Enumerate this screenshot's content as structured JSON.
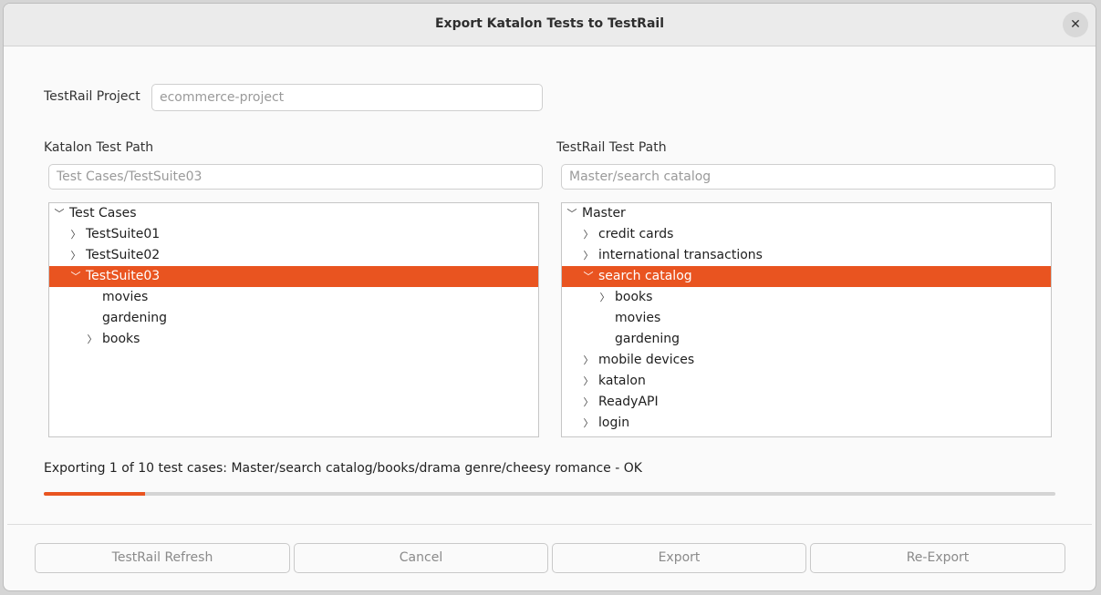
{
  "dialog": {
    "title": "Export Katalon Tests to TestRail",
    "close_glyph": "✕"
  },
  "project": {
    "label": "TestRail Project",
    "value": "ecommerce-project"
  },
  "katalon": {
    "label": "Katalon Test Path",
    "path": "Test Cases/TestSuite03",
    "tree": [
      {
        "label": "Test Cases",
        "level": 0,
        "expander": "expanded",
        "selected": false
      },
      {
        "label": "TestSuite01",
        "level": 1,
        "expander": "collapsed",
        "selected": false
      },
      {
        "label": "TestSuite02",
        "level": 1,
        "expander": "collapsed",
        "selected": false
      },
      {
        "label": "TestSuite03",
        "level": 1,
        "expander": "expanded",
        "selected": true
      },
      {
        "label": "movies",
        "level": 2,
        "expander": "none",
        "selected": false
      },
      {
        "label": "gardening",
        "level": 2,
        "expander": "none",
        "selected": false
      },
      {
        "label": "books",
        "level": 2,
        "expander": "collapsed",
        "selected": false
      }
    ]
  },
  "testrail": {
    "label": "TestRail Test Path",
    "path": "Master/search catalog",
    "tree": [
      {
        "label": "Master",
        "level": 0,
        "expander": "expanded",
        "selected": false
      },
      {
        "label": "credit cards",
        "level": 1,
        "expander": "collapsed",
        "selected": false
      },
      {
        "label": "international transactions",
        "level": 1,
        "expander": "collapsed",
        "selected": false
      },
      {
        "label": "search catalog",
        "level": 1,
        "expander": "expanded",
        "selected": true
      },
      {
        "label": "books",
        "level": 2,
        "expander": "collapsed",
        "selected": false
      },
      {
        "label": "movies",
        "level": 2,
        "expander": "none",
        "selected": false
      },
      {
        "label": "gardening",
        "level": 2,
        "expander": "none",
        "selected": false
      },
      {
        "label": "mobile devices",
        "level": 1,
        "expander": "collapsed",
        "selected": false
      },
      {
        "label": "katalon",
        "level": 1,
        "expander": "collapsed",
        "selected": false
      },
      {
        "label": "ReadyAPI",
        "level": 1,
        "expander": "collapsed",
        "selected": false
      },
      {
        "label": "login",
        "level": 1,
        "expander": "collapsed",
        "selected": false
      }
    ]
  },
  "status": {
    "text": "Exporting 1 of 10 test cases: Master/search catalog/books/drama genre/cheesy romance - OK",
    "progress": 0.1
  },
  "buttons": {
    "refresh": "TestRail Refresh",
    "cancel": "Cancel",
    "export": "Export",
    "reexport": "Re-Export"
  },
  "colors": {
    "accent": "#e95420"
  }
}
